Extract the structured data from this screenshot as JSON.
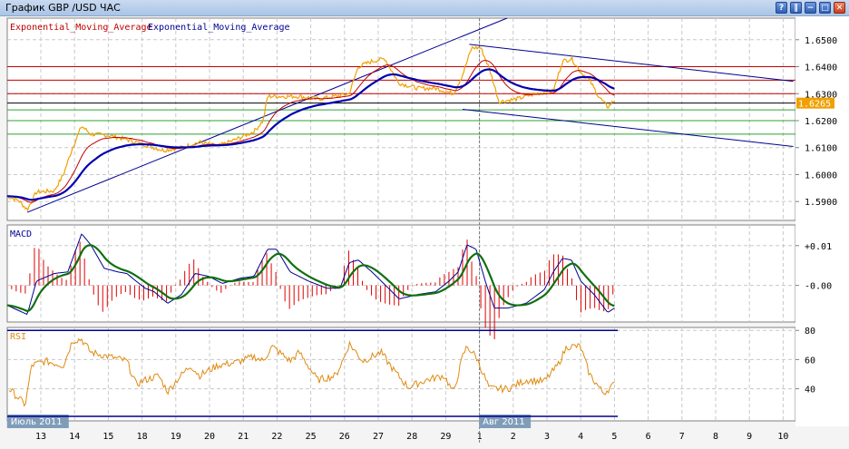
{
  "window": {
    "title": "График GBP /USD  ЧАС",
    "buttons": [
      {
        "name": "help",
        "glyph": "?"
      },
      {
        "name": "pause",
        "glyph": "‖"
      },
      {
        "name": "minimize",
        "glyph": "−"
      },
      {
        "name": "maximize",
        "glyph": "□"
      },
      {
        "name": "close",
        "glyph": "✕"
      }
    ]
  },
  "legend": {
    "ema1": "Exponential_Moving_Average",
    "ema2": "Exponential_Moving_Average",
    "ema1_color": "#c00000",
    "ema2_color": "#000090"
  },
  "chart_data": [
    {
      "type": "line",
      "title": "GBP/USD H1",
      "ylim": [
        1.583,
        1.658
      ],
      "yticks": [
        "1.6500",
        "1.6400",
        "1.6300",
        "1.6200",
        "1.6100",
        "1.6000",
        "1.5900"
      ],
      "current_price": "1.6265",
      "horizontal_levels": {
        "red": [
          1.64,
          1.635,
          1.63
        ],
        "black": [
          1.6265
        ],
        "green": [
          1.624,
          1.62,
          1.615
        ]
      },
      "trendlines": [
        {
          "from": [
            -0.4,
            1.586
          ],
          "to": [
            15.2,
            1.665
          ]
        },
        {
          "from": [
            12.7,
            1.6483
          ],
          "to": [
            22.3,
            1.6346
          ]
        },
        {
          "from": [
            12.5,
            1.6242
          ],
          "to": [
            22.3,
            1.6104
          ]
        }
      ],
      "series": [
        {
          "name": "price",
          "color": "#f0a000",
          "points": [
            [
              -1.0,
              1.592
            ],
            [
              -0.67,
              1.5905
            ],
            [
              -0.4,
              1.587
            ],
            [
              -0.13,
              1.5935
            ],
            [
              0.4,
              1.594
            ],
            [
              0.67,
              1.6
            ],
            [
              0.94,
              1.61
            ],
            [
              1.21,
              1.618
            ],
            [
              1.48,
              1.615
            ],
            [
              2.02,
              1.6145
            ],
            [
              2.55,
              1.613
            ],
            [
              3.09,
              1.611
            ],
            [
              3.63,
              1.609
            ],
            [
              4.17,
              1.61
            ],
            [
              4.7,
              1.612
            ],
            [
              5.24,
              1.6105
            ],
            [
              5.78,
              1.613
            ],
            [
              6.32,
              1.616
            ],
            [
              6.59,
              1.62
            ],
            [
              6.72,
              1.629
            ],
            [
              7.12,
              1.629
            ],
            [
              7.66,
              1.629
            ],
            [
              8.2,
              1.628
            ],
            [
              8.74,
              1.629
            ],
            [
              9.14,
              1.63
            ],
            [
              9.41,
              1.64
            ],
            [
              9.81,
              1.642
            ],
            [
              10.2,
              1.643
            ],
            [
              10.6,
              1.634
            ],
            [
              11.16,
              1.632
            ],
            [
              11.7,
              1.632
            ],
            [
              12.23,
              1.63
            ],
            [
              12.5,
              1.637
            ],
            [
              12.77,
              1.647
            ],
            [
              13.04,
              1.647
            ],
            [
              13.3,
              1.639
            ],
            [
              13.58,
              1.627
            ],
            [
              14.1,
              1.628
            ],
            [
              14.65,
              1.63
            ],
            [
              15.19,
              1.631
            ],
            [
              15.46,
              1.642
            ],
            [
              15.73,
              1.643
            ],
            [
              16.0,
              1.638
            ],
            [
              16.26,
              1.635
            ],
            [
              16.53,
              1.629
            ],
            [
              16.8,
              1.625
            ],
            [
              17.0,
              1.6275
            ]
          ]
        }
      ]
    },
    {
      "type": "line",
      "title": "MACD",
      "ylim": [
        -0.0092,
        0.0152
      ],
      "yticks": [
        "+0.01",
        "-0.00"
      ],
      "series": [
        {
          "name": "MACD",
          "color": "#000090",
          "points": [
            [
              -1.0,
              -0.005
            ],
            [
              -0.4,
              -0.0073
            ],
            [
              -0.13,
              0.0011
            ],
            [
              0.4,
              0.003
            ],
            [
              0.8,
              0.0034
            ],
            [
              1.21,
              0.013
            ],
            [
              1.48,
              0.0102
            ],
            [
              1.88,
              0.0043
            ],
            [
              2.28,
              0.0034
            ],
            [
              2.55,
              0.003
            ],
            [
              2.82,
              0.0011
            ],
            [
              3.09,
              -0.0007
            ],
            [
              3.36,
              -0.0016
            ],
            [
              3.76,
              -0.0045
            ],
            [
              4.17,
              -0.0023
            ],
            [
              4.57,
              0.003
            ],
            [
              4.97,
              0.0023
            ],
            [
              5.38,
              0.0005
            ],
            [
              5.91,
              0.0018
            ],
            [
              6.32,
              0.0023
            ],
            [
              6.72,
              0.0091
            ],
            [
              6.99,
              0.0091
            ],
            [
              7.39,
              0.0034
            ],
            [
              7.93,
              0.0011
            ],
            [
              8.47,
              -0.0007
            ],
            [
              8.87,
              -0.0007
            ],
            [
              9.14,
              0.0057
            ],
            [
              9.41,
              0.0064
            ],
            [
              9.81,
              0.0034
            ],
            [
              10.22,
              0.0
            ],
            [
              10.62,
              -0.0034
            ],
            [
              11.16,
              -0.0023
            ],
            [
              11.7,
              -0.0016
            ],
            [
              12.1,
              0.0011
            ],
            [
              12.37,
              0.0034
            ],
            [
              12.63,
              0.0102
            ],
            [
              12.9,
              0.0091
            ],
            [
              13.17,
              0.0011
            ],
            [
              13.44,
              -0.0057
            ],
            [
              13.84,
              -0.0057
            ],
            [
              14.38,
              -0.0045
            ],
            [
              14.92,
              -0.0011
            ],
            [
              15.19,
              0.0034
            ],
            [
              15.46,
              0.0068
            ],
            [
              15.73,
              0.0064
            ],
            [
              16.0,
              0.0011
            ],
            [
              16.4,
              -0.0023
            ],
            [
              16.8,
              -0.0068
            ],
            [
              17.0,
              -0.0057
            ]
          ]
        }
      ]
    },
    {
      "type": "line",
      "title": "RSI",
      "ylim": [
        18,
        82
      ],
      "yticks": [
        "80",
        "60",
        "40"
      ],
      "levels": [
        80,
        20
      ],
      "series": [
        {
          "name": "RSI",
          "color": "#e08a10",
          "points": [
            [
              -0.94,
              40
            ],
            [
              -0.46,
              29
            ],
            [
              -0.27,
              56
            ],
            [
              0.13,
              59
            ],
            [
              0.67,
              56
            ],
            [
              0.94,
              73
            ],
            [
              1.21,
              74
            ],
            [
              1.48,
              65
            ],
            [
              2.02,
              62
            ],
            [
              2.55,
              59
            ],
            [
              2.82,
              43
            ],
            [
              3.09,
              46
            ],
            [
              3.49,
              49
            ],
            [
              3.76,
              38
            ],
            [
              4.03,
              46
            ],
            [
              4.44,
              56
            ],
            [
              4.7,
              49
            ],
            [
              5.24,
              56
            ],
            [
              5.78,
              58
            ],
            [
              6.32,
              62
            ],
            [
              6.59,
              59
            ],
            [
              6.85,
              69
            ],
            [
              7.39,
              59
            ],
            [
              7.66,
              65
            ],
            [
              8.2,
              46
            ],
            [
              8.74,
              49
            ],
            [
              9.0,
              62
            ],
            [
              9.14,
              71
            ],
            [
              9.54,
              59
            ],
            [
              10.08,
              65
            ],
            [
              10.48,
              52
            ],
            [
              10.89,
              41
            ],
            [
              11.42,
              46
            ],
            [
              11.96,
              49
            ],
            [
              12.23,
              37
            ],
            [
              12.5,
              62
            ],
            [
              12.63,
              69
            ],
            [
              12.9,
              62
            ],
            [
              13.3,
              40
            ],
            [
              13.84,
              40
            ],
            [
              14.38,
              46
            ],
            [
              14.92,
              45
            ],
            [
              15.32,
              56
            ],
            [
              15.59,
              69
            ],
            [
              15.99,
              69
            ],
            [
              16.26,
              50
            ],
            [
              16.67,
              37
            ],
            [
              17.0,
              43
            ]
          ]
        }
      ]
    }
  ],
  "xaxis": {
    "ticks": [
      "13",
      "14",
      "15",
      "18",
      "19",
      "20",
      "21",
      "22",
      "25",
      "26",
      "27",
      "28",
      "29",
      "1",
      "2",
      "3",
      "4",
      "5",
      "6",
      "7",
      "8",
      "9",
      "10"
    ],
    "months": [
      {
        "label": "Июль 2011",
        "at": -1.0
      },
      {
        "label": "Авг 2011",
        "at": 12.8
      }
    ],
    "separator_at": 13
  },
  "panels": {
    "macd_label": "MACD",
    "rsi_label": "RSI"
  },
  "colors": {
    "bg": "#ffffff",
    "grid": "#c8c8c8",
    "price": "#f0a000",
    "ema_fast": "#c00000",
    "ema_slow": "#0000b0",
    "signal": "#107010",
    "hist": "#e00000",
    "price_tag": "#f0a000"
  }
}
